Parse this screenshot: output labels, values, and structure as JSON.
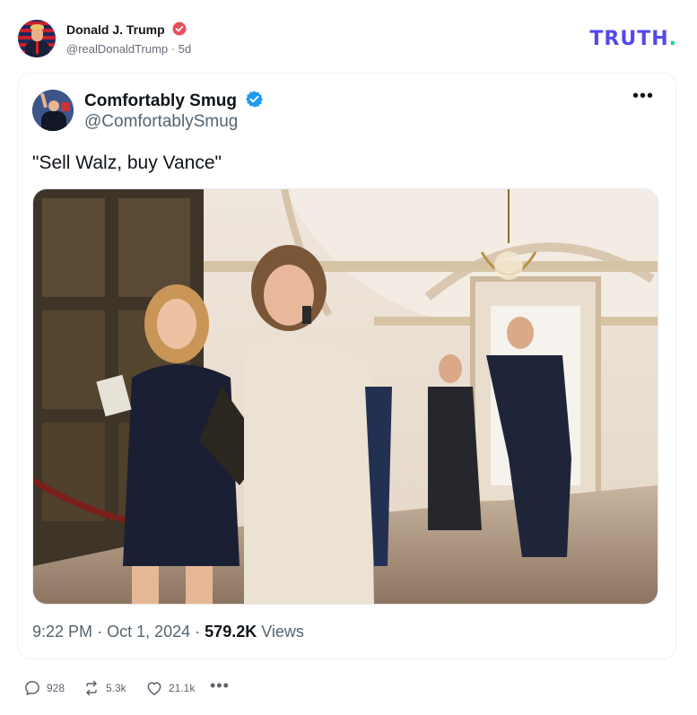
{
  "post": {
    "author_name": "Donald J. Trump",
    "author_handle": "@realDonaldTrump",
    "separator": "·",
    "age": "5d"
  },
  "brand": {
    "logo_text": "TRUTH",
    "logo_dot": ".",
    "color": "#5448ee",
    "dot_color": "#13d2a1"
  },
  "tweet": {
    "author_name": "Comfortably Smug",
    "author_handle": "@ComfortablySmug",
    "text": "\"Sell Walz, buy Vance\"",
    "more_label": "•••",
    "time": "9:22 PM",
    "date": "Oct 1, 2024",
    "views_count": "579.2K",
    "views_label": "Views",
    "verified_color": "#1d9bf0"
  },
  "actions": {
    "replies": "928",
    "retruths": "5.3k",
    "likes": "21.1k",
    "more": "•••"
  },
  "icons": {
    "verified_truth": "verified-badge-icon",
    "verified_twitter": "verified-check-icon",
    "reply": "speech-bubble-icon",
    "retruth": "repost-arrows-icon",
    "like": "heart-icon",
    "more": "ellipsis-icon"
  }
}
